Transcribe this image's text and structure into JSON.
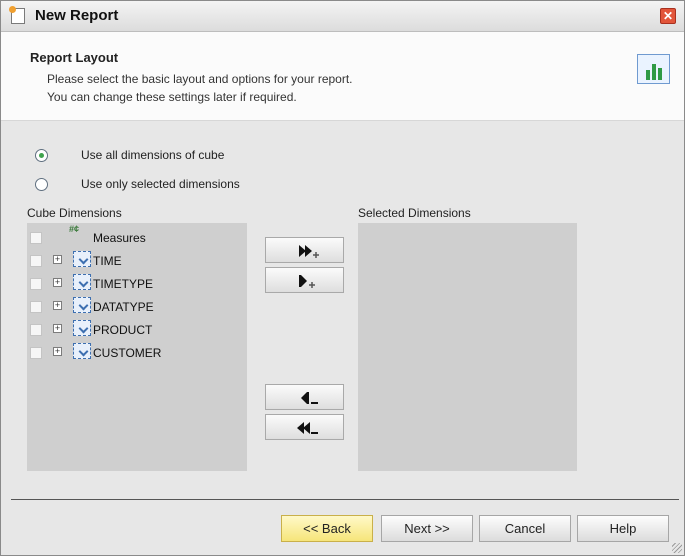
{
  "window": {
    "title": "New Report"
  },
  "header": {
    "title": "Report Layout",
    "desc_line1": "Please select the basic layout and options for your report.",
    "desc_line2": "You can change these settings later if required."
  },
  "options": {
    "all_dimensions": "Use all dimensions of cube",
    "selected_dimensions": "Use only selected dimensions",
    "selected_option": "all_dimensions"
  },
  "cube_panel": {
    "label": "Cube Dimensions",
    "items": [
      {
        "label": "Measures",
        "icon": "measures-icon"
      },
      {
        "label": "TIME",
        "icon": "dimension-icon"
      },
      {
        "label": "TIMETYPE",
        "icon": "dimension-icon"
      },
      {
        "label": "DATATYPE",
        "icon": "dimension-icon"
      },
      {
        "label": "PRODUCT",
        "icon": "dimension-icon"
      },
      {
        "label": "CUSTOMER",
        "icon": "dimension-icon"
      }
    ]
  },
  "selected_panel": {
    "label": "Selected Dimensions",
    "items": []
  },
  "move_buttons": {
    "add_all": "add-all-icon",
    "add_one": "add-one-icon",
    "remove_one": "remove-one-icon",
    "remove_all": "remove-all-icon"
  },
  "footer": {
    "back": "<< Back",
    "next": "Next >>",
    "cancel": "Cancel",
    "help": "Help"
  },
  "colors": {
    "primary_button": "#f6e57a",
    "radio_selected": "#3fa34d",
    "panel": "#cfcfcf"
  }
}
